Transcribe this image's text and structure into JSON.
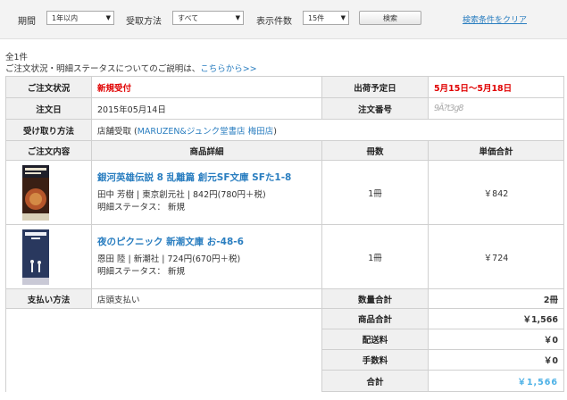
{
  "filters": {
    "period_label": "期間",
    "period_value": "1年以内",
    "receive_label": "受取方法",
    "receive_value": "すべて",
    "count_label": "表示件数",
    "count_value": "15件",
    "search_button": "検索",
    "clear_link": "検索条件をクリア"
  },
  "summary": {
    "count": "全1件",
    "explanation": "ご注文状況・明細ステータスについてのご説明は、",
    "explanation_link": "こちらから>>"
  },
  "order": {
    "status_label": "ご注文状況",
    "status_value": "新規受付",
    "ship_label": "出荷予定日",
    "ship_value": "5月15日～5月18日",
    "date_label": "注文日",
    "date_value": "2015年05月14日",
    "number_label": "注文番号",
    "number_value": "9Ā?t3g8",
    "pickup_label": "受け取り方法",
    "pickup_prefix": "店舗受取 (",
    "pickup_store": "MARUZEN&ジュンク堂書店 梅田店",
    "pickup_suffix": ")",
    "contents_header": "ご注文内容",
    "details_header": "商品詳細",
    "qty_header": "冊数",
    "price_header": "単価合計",
    "items": [
      {
        "title": "銀河英雄伝説 8 乱離篇 創元SF文庫 SFた1-8",
        "meta": "田中 芳樹 | 東京創元社 | 842円(780円＋税)",
        "status": "明細ステータス： 新規",
        "qty": "1冊",
        "price": "￥842",
        "cover_color": "#8a3a1e"
      },
      {
        "title": "夜のピクニック 新潮文庫 お-48-6",
        "meta": "恩田 陸 | 新潮社 | 724円(670円＋税)",
        "status": "明細ステータス： 新規",
        "qty": "1冊",
        "price": "￥724",
        "cover_color": "#2f3a63"
      }
    ],
    "payment_label": "支払い方法",
    "payment_value": "店頭支払い",
    "totals": {
      "qty_label": "数量合計",
      "qty_value": "2冊",
      "goods_label": "商品合計",
      "goods_value": "￥1,566",
      "shipping_label": "配送料",
      "shipping_value": "￥0",
      "fee_label": "手数料",
      "fee_value": "￥0",
      "total_label": "合計",
      "total_value": "￥1,566"
    }
  },
  "colors": {
    "accent_link": "#2a7ec0",
    "status_red": "#e00000",
    "total_blue": "#4db1e6"
  }
}
